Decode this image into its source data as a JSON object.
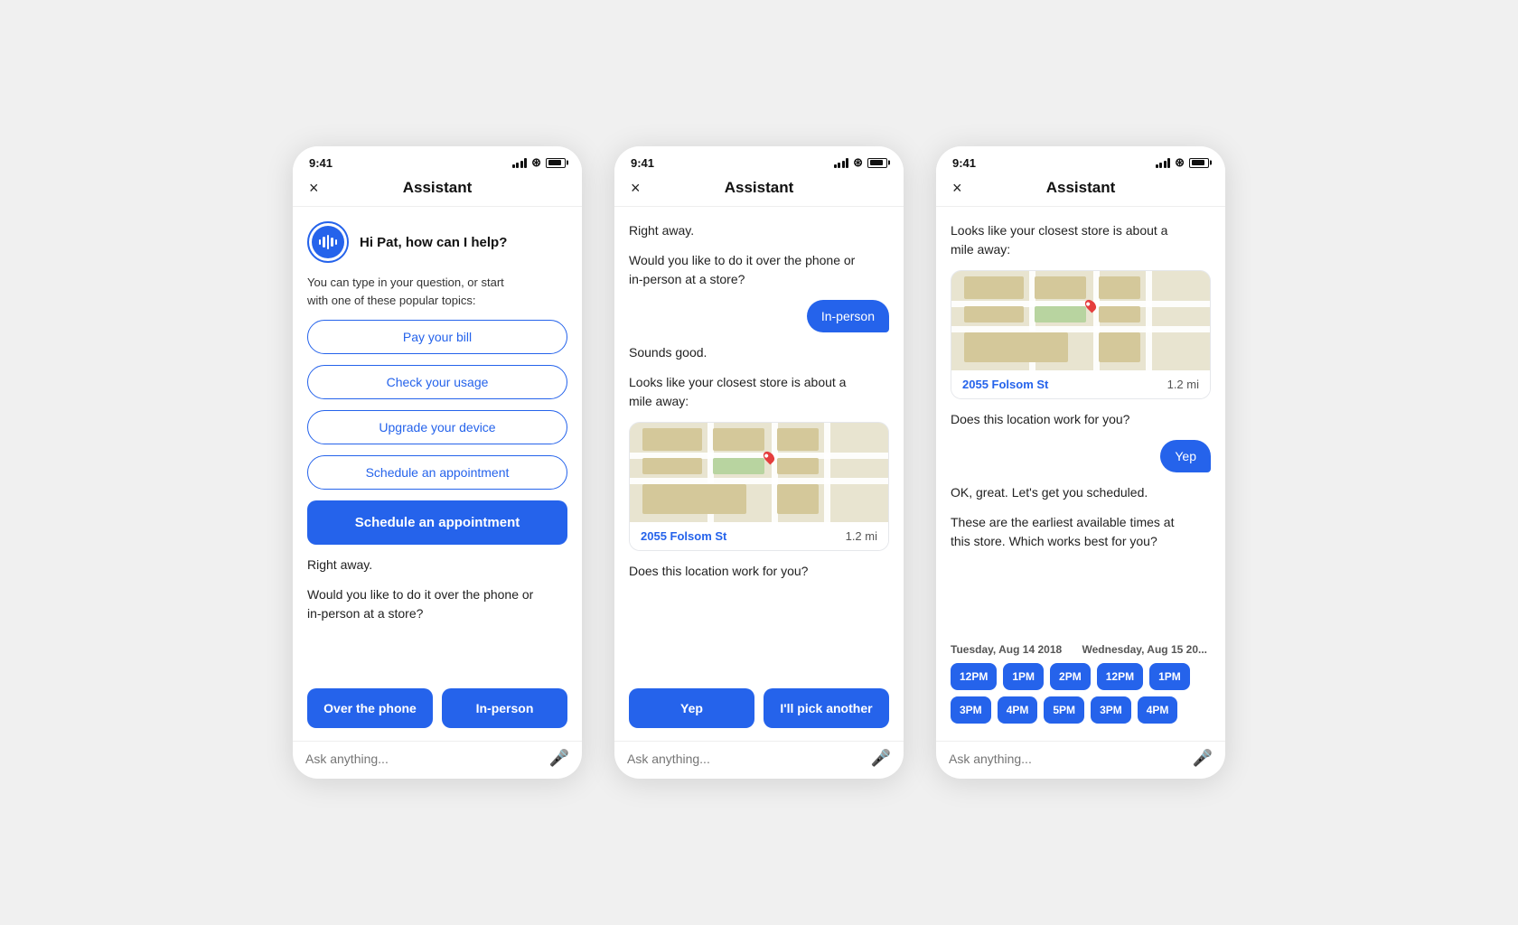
{
  "screens": [
    {
      "id": "screen1",
      "time": "9:41",
      "header": {
        "close": "×",
        "title": "Assistant"
      },
      "greeting": "Hi Pat, how can I help?",
      "subtitle": "You can type in your question, or start\nwith one of these popular topics:",
      "quick_replies": [
        "Pay your bill",
        "Check your usage",
        "Upgrade your device",
        "Schedule an appointment"
      ],
      "cta_label": "Schedule an appointment",
      "bot_msg1": "Right away.",
      "bot_msg2": "Would you like to do it over the phone or\nin-person at a store?",
      "btn_left": "Over the phone",
      "btn_right": "In-person",
      "input_placeholder": "Ask anything..."
    },
    {
      "id": "screen2",
      "time": "9:41",
      "header": {
        "close": "×",
        "title": "Assistant"
      },
      "bot_msg1": "Right away.",
      "bot_msg2": "Would you like to do it over the phone or\nin-person at a store?",
      "user_msg": "In-person",
      "bot_msg3": "Sounds good.",
      "bot_msg4": "Looks like your closest store is about a\nmile away:",
      "map_address": "2055 Folsom St",
      "map_distance": "1.2 mi",
      "bot_msg5": "Does this location work for you?",
      "btn_left": "Yep",
      "btn_right": "I'll pick another",
      "input_placeholder": "Ask anything..."
    },
    {
      "id": "screen3",
      "time": "9:41",
      "header": {
        "close": "×",
        "title": "Assistant"
      },
      "bot_msg1": "Looks like your closest store is about a\nmile away:",
      "map_address": "2055 Folsom St",
      "map_distance": "1.2 mi",
      "bot_msg2": "Does this location work for you?",
      "user_msg": "Yep",
      "bot_msg3": "OK, great. Let's get you scheduled.",
      "bot_msg4": "These are the earliest available times at\nthis store. Which works best for you?",
      "slot_day1": "Tuesday, Aug 14 2018",
      "slot_day2": "Wednesday, Aug 15 20...",
      "slots_row1_day1": [
        "12PM",
        "1PM",
        "2PM"
      ],
      "slots_row1_day2": [
        "12PM",
        "1PM"
      ],
      "slots_row2_day1": [
        "3PM",
        "4PM",
        "5PM"
      ],
      "slots_row2_day2": [
        "3PM",
        "4PM"
      ],
      "input_placeholder": "Ask anything..."
    }
  ]
}
